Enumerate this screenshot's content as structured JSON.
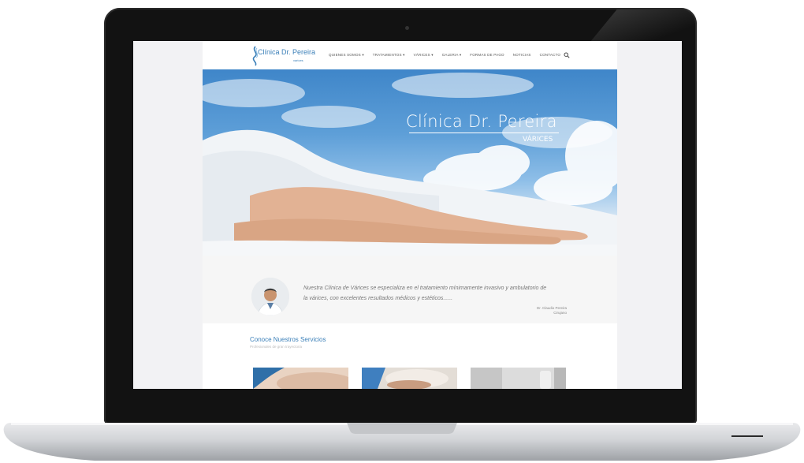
{
  "site": {
    "logo_text": "Clínica Dr. Pereira",
    "logo_sub": "varices",
    "menu": [
      "QUIENES SOMOS",
      "TRATAMIENTOS",
      "VÁRICES",
      "GALERIA",
      "FORMAS DE PAGO",
      "NOTICIAS",
      "CONTACTO"
    ],
    "menu_dropdown_flags": [
      true,
      true,
      true,
      true,
      false,
      false,
      false
    ]
  },
  "hero": {
    "title": "Clínica Dr. Pereira",
    "subtitle": "VÁRICES"
  },
  "testimonial": {
    "quote": "Nuestra Clínica de Várices se especializa en el tratamiento mínimamente invasivo y ambulatorio de la várices, con excelentes resultados médicos y estéticos......",
    "author_name": "Dr. Claudio Pereira",
    "author_role": "Cirujano"
  },
  "services": {
    "title": "Conoce Nuestros Servicios",
    "subtitle": "Profesionales de gran trayectoria"
  },
  "colors": {
    "brand_blue": "#3a7fb8",
    "sky_top": "#3f86c9"
  },
  "icons": [
    "search-icon",
    "chevron-down-icon"
  ]
}
